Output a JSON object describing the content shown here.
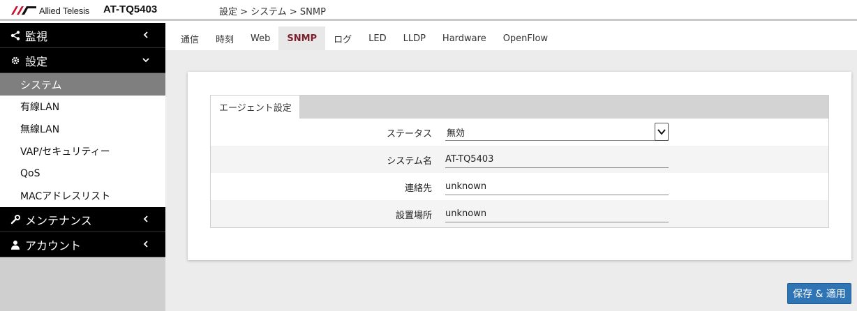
{
  "header": {
    "brand": "Allied Telesis",
    "model": "AT-TQ5403",
    "breadcrumb": "設定 > システム > SNMP"
  },
  "sidebar": {
    "sections": [
      {
        "label": "監視",
        "icon": "share-icon",
        "expanded": false
      },
      {
        "label": "設定",
        "icon": "gear-icon",
        "expanded": true
      },
      {
        "label": "メンテナンス",
        "icon": "wrench-icon",
        "expanded": false
      },
      {
        "label": "アカウント",
        "icon": "user-icon",
        "expanded": false
      }
    ],
    "items": [
      {
        "label": "システム",
        "active": true
      },
      {
        "label": "有線LAN"
      },
      {
        "label": "無線LAN"
      },
      {
        "label": "VAP/セキュリティー"
      },
      {
        "label": "QoS"
      },
      {
        "label": "MACアドレスリスト"
      }
    ]
  },
  "tabs": [
    "通信",
    "時刻",
    "Web",
    "SNMP",
    "ログ",
    "LED",
    "LLDP",
    "Hardware",
    "OpenFlow"
  ],
  "active_tab": "SNMP",
  "agent": {
    "tab_label": "エージェント設定",
    "status_label": "ステータス",
    "status_value": "無効",
    "sysname_label": "システム名",
    "sysname_value": "AT-TQ5403",
    "contact_label": "連絡先",
    "contact_value": "unknown",
    "location_label": "設置場所",
    "location_value": "unknown"
  },
  "actions": {
    "save_label": "保存 & 適用"
  },
  "colors": {
    "accent": "#2f75b5",
    "active_tab_text": "#7a1f2b",
    "sidebar_section_bg": "#000000",
    "sidebar_active_bg": "#7f7f7f"
  }
}
